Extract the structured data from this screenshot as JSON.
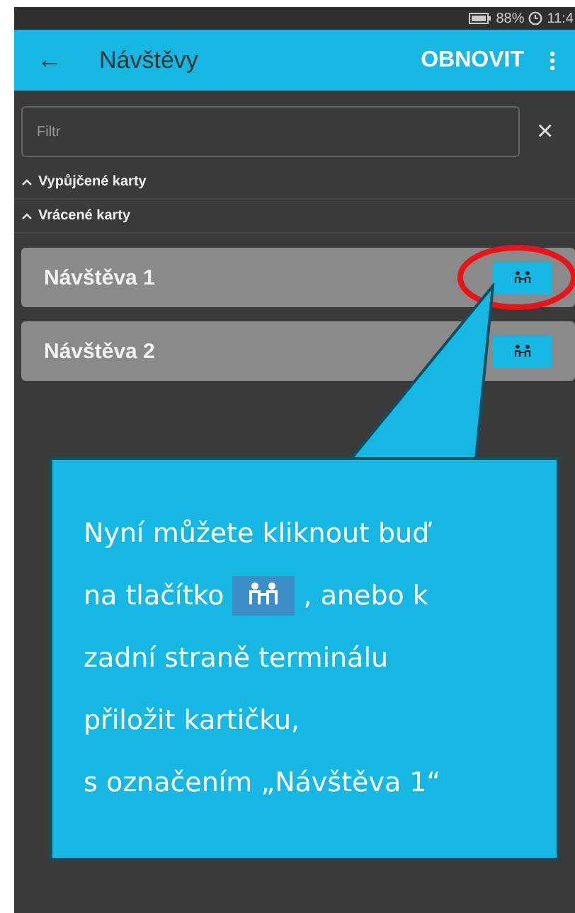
{
  "status_bar": {
    "battery": "88%",
    "time": "11:4"
  },
  "app_bar": {
    "back": "←",
    "title": "Návštěvy",
    "action": "OBNOVIT"
  },
  "filter": {
    "placeholder": "Filtr",
    "clear": "×"
  },
  "sections": [
    {
      "title": "Vypůjčené karty",
      "expanded": true
    },
    {
      "title": "Vrácené karty",
      "expanded": true,
      "items": [
        {
          "name": "Návštěva 1",
          "highlighted": true
        },
        {
          "name": "Návštěva 2",
          "highlighted": false
        }
      ]
    }
  ],
  "callout": {
    "lines": [
      [
        {
          "kind": "text",
          "text": "Nyní můžete kliknout buď"
        }
      ],
      [
        {
          "kind": "text",
          "text": "na tlačítko"
        },
        {
          "kind": "icon"
        },
        {
          "kind": "text",
          "text": ", anebo k"
        }
      ],
      [
        {
          "kind": "text",
          "text": "zadní straně terminálu"
        }
      ],
      [
        {
          "kind": "text",
          "text": "přiložit kartičku,"
        }
      ],
      [
        {
          "kind": "text",
          "text": "s označením „Návštěva 1“"
        }
      ]
    ]
  }
}
